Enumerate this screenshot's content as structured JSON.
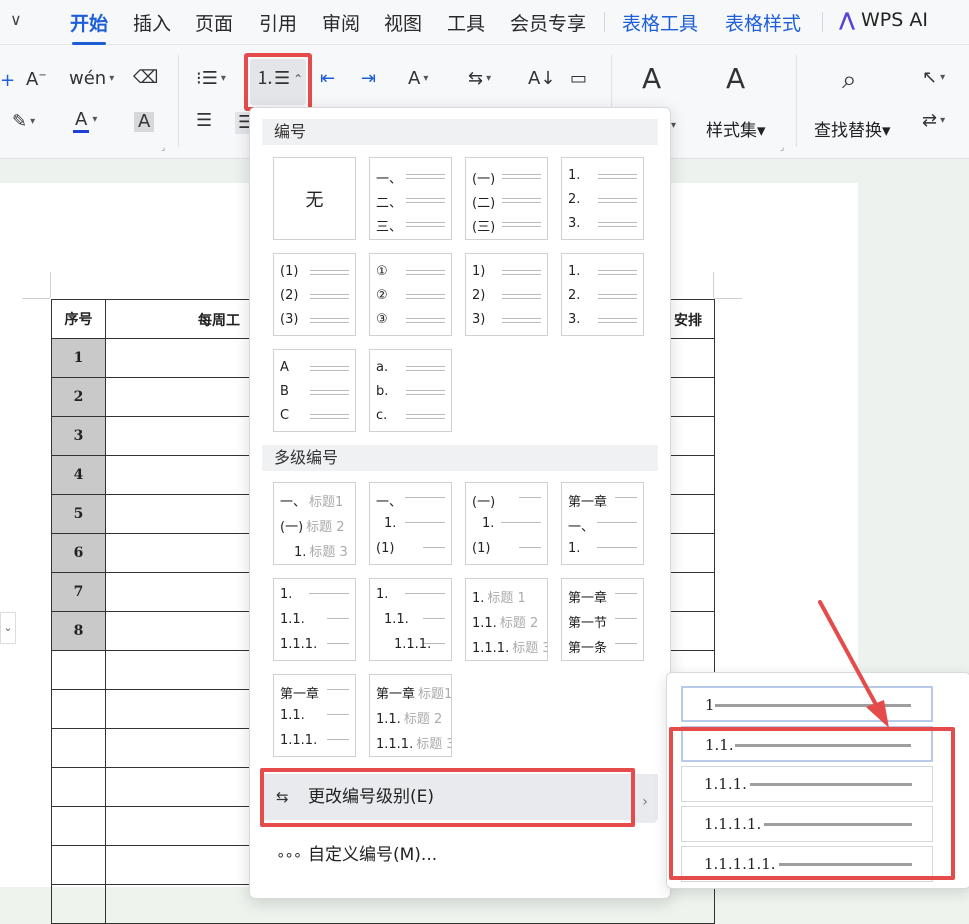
{
  "menu": {
    "collapse_icon": "chevron-down-icon",
    "tabs": [
      "开始",
      "插入",
      "页面",
      "引用",
      "审阅",
      "视图",
      "工具",
      "会员专享"
    ],
    "context_tabs": [
      "表格工具",
      "表格样式"
    ],
    "ai_label": "WPS AI"
  },
  "ribbon": {
    "style_set_label": "样式集",
    "find_replace_label": "查找替换",
    "font_color_accent": "#1f3fd6"
  },
  "dropdown": {
    "section_numbering": "编号",
    "none_label": "无",
    "presets": [
      [
        "一、",
        "二、",
        "三、"
      ],
      [
        "(一)",
        "(二)",
        "(三)"
      ],
      [
        "1.",
        "2.",
        "3."
      ],
      [
        "(1)",
        "(2)",
        "(3)"
      ],
      [
        "①",
        "②",
        "③"
      ],
      [
        "1)",
        "2)",
        "3)"
      ],
      [
        "1.",
        "2.",
        "3."
      ],
      [
        "A",
        "B",
        "C"
      ],
      [
        "a.",
        "b.",
        "c."
      ]
    ],
    "section_multilevel": "多级编号",
    "multilevel": [
      [
        {
          "m": "一、",
          "g": "标题1"
        },
        {
          "m": "(一)",
          "g": "标题 2"
        },
        {
          "m": "1.",
          "g": "标题 3"
        }
      ],
      [
        {
          "m": "一、",
          "g": ""
        },
        {
          "m": "1.",
          "g": ""
        },
        {
          "m": "(1)",
          "g": ""
        }
      ],
      [
        {
          "m": "(一)",
          "g": ""
        },
        {
          "m": "1.",
          "g": ""
        },
        {
          "m": "(1)",
          "g": ""
        }
      ],
      [
        {
          "m": "第一章",
          "g": ""
        },
        {
          "m": "一、",
          "g": ""
        },
        {
          "m": "1.",
          "g": ""
        }
      ],
      [
        {
          "m": "1.",
          "g": ""
        },
        {
          "m": "1.1.",
          "g": ""
        },
        {
          "m": "1.1.1.",
          "g": ""
        }
      ],
      [
        {
          "m": "1.",
          "g": ""
        },
        {
          "m": "1.1.",
          "g": ""
        },
        {
          "m": "1.1.1.",
          "g": ""
        }
      ],
      [
        {
          "m": "1.",
          "g": "标题 1"
        },
        {
          "m": "1.1.",
          "g": "标题 2"
        },
        {
          "m": "1.1.1.",
          "g": "标题 3"
        }
      ],
      [
        {
          "m": "第一章",
          "g": ""
        },
        {
          "m": "第一节",
          "g": ""
        },
        {
          "m": "第一条",
          "g": ""
        }
      ],
      [
        {
          "m": "第一章",
          "g": ""
        },
        {
          "m": "1.1.",
          "g": ""
        },
        {
          "m": "1.1.1.",
          "g": ""
        }
      ],
      [
        {
          "m": "第一章",
          "g": "标题1"
        },
        {
          "m": "1.1.",
          "g": "标题 2"
        },
        {
          "m": "1.1.1.",
          "g": "标题 3"
        }
      ]
    ],
    "change_level_label": "更改编号级别(E)",
    "custom_label": "自定义编号(M)...",
    "submenu_chevron": "›"
  },
  "levels": [
    "1",
    "1.1.",
    "1.1.1.",
    "1.1.1.1.",
    "1.1.1.1.1."
  ],
  "table": {
    "header_seq": "序号",
    "header_main": "每周工",
    "header_right": "安排",
    "rows": [
      "1",
      "2",
      "3",
      "4",
      "5",
      "6",
      "7",
      "8",
      "",
      "",
      "",
      "",
      "",
      "",
      ""
    ]
  },
  "colors": {
    "accent": "#1e5fd8",
    "highlight_red": "#e54b4b",
    "shade_gray": "#c9c9c9"
  }
}
